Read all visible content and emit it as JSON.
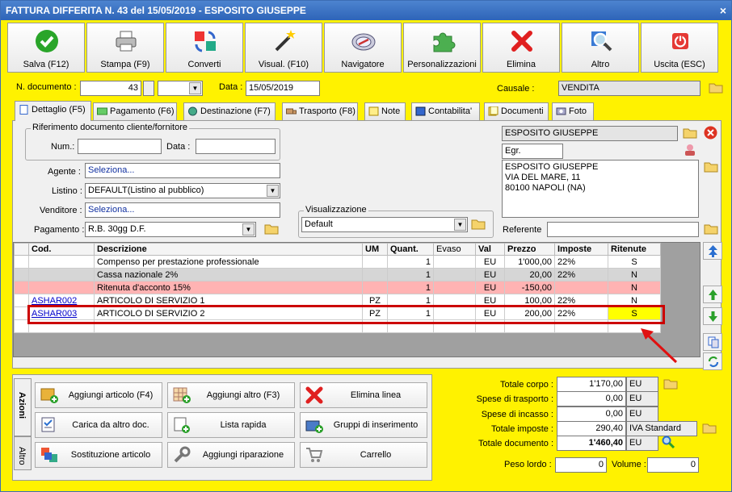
{
  "window": {
    "title": "FATTURA DIFFERITA N. 43 del 15/05/2019 - ESPOSITO GIUSEPPE",
    "close": "×"
  },
  "toolbar": [
    {
      "label": "Salva (F12)",
      "icon": "check-icon"
    },
    {
      "label": "Stampa (F9)",
      "icon": "printer-icon"
    },
    {
      "label": "Converti",
      "icon": "convert-icon"
    },
    {
      "label": "Visual. (F10)",
      "icon": "magic-wand-icon"
    },
    {
      "label": "Navigatore",
      "icon": "compass-icon"
    },
    {
      "label": "Personalizzazioni",
      "icon": "puzzle-icon"
    },
    {
      "label": "Elimina",
      "icon": "delete-x-icon"
    },
    {
      "label": "Altro",
      "icon": "magnifier-icon"
    },
    {
      "label": "Uscita (ESC)",
      "icon": "power-icon"
    }
  ],
  "header": {
    "ndoc_label": "N. documento :",
    "ndoc_value": "43",
    "data_label": "Data :",
    "data_value": "15/05/2019",
    "causale_label": "Causale :",
    "causale_value": "VENDITA"
  },
  "tabs": [
    {
      "label": "Dettaglio (F5)"
    },
    {
      "label": "Pagamento (F6)"
    },
    {
      "label": "Destinazione (F7)"
    },
    {
      "label": "Trasporto (F8)"
    },
    {
      "label": "Note"
    },
    {
      "label": "Contabilita'"
    },
    {
      "label": "Documenti"
    },
    {
      "label": "Foto"
    }
  ],
  "riferimento": {
    "title": "Riferimento documento cliente/fornitore",
    "num_label": "Num.:",
    "data_label": "Data :"
  },
  "fields": {
    "agente_label": "Agente :",
    "agente_value": "Seleziona...",
    "listino_label": "Listino :",
    "listino_value": "DEFAULT(Listino al pubblico)",
    "venditore_label": "Venditore :",
    "venditore_value": "Seleziona...",
    "pagamento_label": "Pagamento :",
    "pagamento_value": "R.B. 30gg D.F.",
    "visualizzazione_title": "Visualizzazione",
    "visualizzazione_value": "Default"
  },
  "cliente": {
    "name": "ESPOSITO GIUSEPPE",
    "prefix": "Egr.",
    "address": [
      "ESPOSITO GIUSEPPE",
      "VIA DEL MARE, 11",
      "80100 NAPOLI (NA)"
    ],
    "referente_label": "Referente"
  },
  "grid": {
    "columns": [
      "Cod.",
      "Descrizione",
      "UM",
      "Quant.",
      "Evaso",
      "Val",
      "Prezzo",
      "Imposte",
      "Ritenute"
    ],
    "rows": [
      {
        "cod": "",
        "desc": "Compenso per prestazione professionale",
        "um": "",
        "qty": "1",
        "evaso": "",
        "val": "EU",
        "prezzo": "1'000,00",
        "imposte": "22%",
        "ritenute": "S",
        "style": ""
      },
      {
        "cod": "",
        "desc": "Cassa nazionale 2%",
        "um": "",
        "qty": "1",
        "evaso": "",
        "val": "EU",
        "prezzo": "20,00",
        "imposte": "22%",
        "ritenute": "N",
        "style": "gray"
      },
      {
        "cod": "",
        "desc": "Ritenuta d'acconto 15%",
        "um": "",
        "qty": "1",
        "evaso": "",
        "val": "EU",
        "prezzo": "-150,00",
        "imposte": "",
        "ritenute": "N",
        "style": "pink"
      },
      {
        "cod": "ASHAR002",
        "desc": "ARTICOLO DI SERVIZIO 1",
        "um": "PZ",
        "qty": "1",
        "evaso": "",
        "val": "EU",
        "prezzo": "100,00",
        "imposte": "22%",
        "ritenute": "N",
        "style": ""
      },
      {
        "cod": "ASHAR003",
        "desc": "ARTICOLO DI SERVIZIO 2",
        "um": "PZ",
        "qty": "1",
        "evaso": "",
        "val": "EU",
        "prezzo": "200,00",
        "imposte": "22%",
        "ritenute": "S",
        "style": "selected"
      }
    ]
  },
  "actions_tabs": [
    "Azioni",
    "Altro"
  ],
  "actions": [
    {
      "label": "Aggiungi articolo (F4)",
      "icon": "add-article-icon"
    },
    {
      "label": "Aggiungi altro (F3)",
      "icon": "add-other-icon"
    },
    {
      "label": "Elimina linea",
      "icon": "delete-line-icon"
    },
    {
      "label": "Carica da altro doc.",
      "icon": "load-doc-icon"
    },
    {
      "label": "Lista rapida",
      "icon": "quick-list-icon"
    },
    {
      "label": "Gruppi di inserimento",
      "icon": "groups-icon"
    },
    {
      "label": "Sostituzione articolo",
      "icon": "replace-article-icon"
    },
    {
      "label": "Aggiungi riparazione",
      "icon": "wrench-icon"
    },
    {
      "label": "Carrello",
      "icon": "cart-icon"
    }
  ],
  "totals": [
    {
      "label": "Totale corpo :",
      "value": "1'170,00",
      "suffix": "EU"
    },
    {
      "label": "Spese di trasporto :",
      "value": "0,00",
      "suffix": "EU"
    },
    {
      "label": "Spese di incasso :",
      "value": "0,00",
      "suffix": "EU"
    },
    {
      "label": "Totale imposte :",
      "value": "290,40",
      "suffix": "IVA Standard"
    },
    {
      "label": "Totale documento :",
      "value": "1'460,40",
      "suffix": "EU"
    }
  ],
  "weights": {
    "peso_label": "Peso lordo :",
    "peso_value": "0",
    "volume_label": "Volume :",
    "volume_value": "0"
  }
}
